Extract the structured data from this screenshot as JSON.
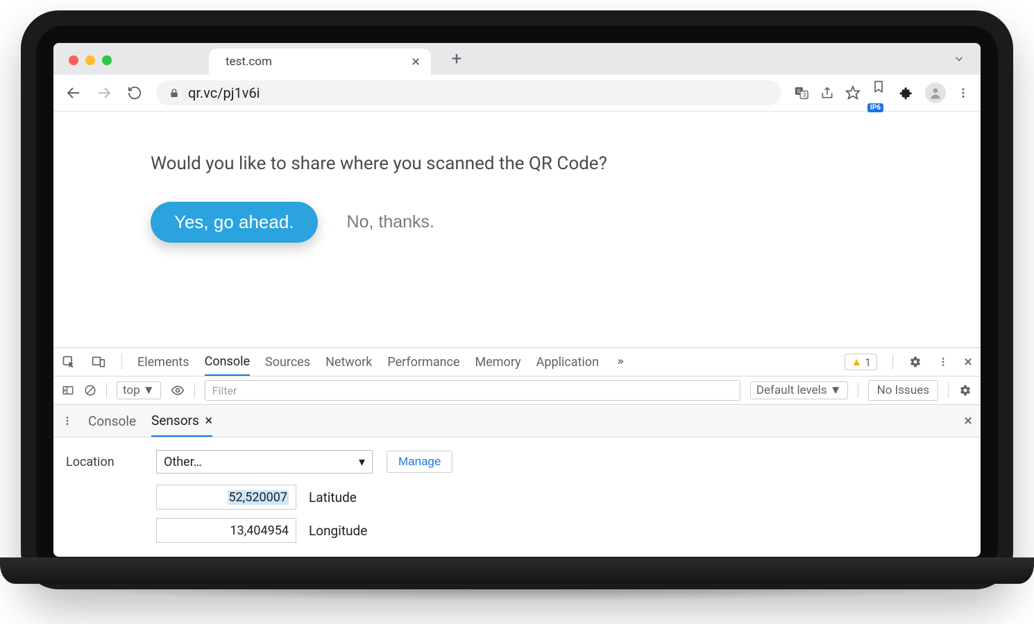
{
  "browser": {
    "tab_title": "test.com",
    "url": "qr.vc/pj1v6i",
    "ip_badge": "IP6"
  },
  "page": {
    "question": "Would you like to share where you scanned the QR Code?",
    "yes": "Yes, go ahead.",
    "no": "No, thanks."
  },
  "devtools": {
    "tabs": [
      "Elements",
      "Console",
      "Sources",
      "Network",
      "Performance",
      "Memory",
      "Application"
    ],
    "active_tab": "Console",
    "warning_count": "1",
    "context": "top",
    "filter_placeholder": "Filter",
    "levels": "Default levels",
    "issues": "No Issues"
  },
  "drawer": {
    "tabs": [
      "Console",
      "Sensors"
    ],
    "active_tab": "Sensors"
  },
  "sensors": {
    "section": "Location",
    "preset": "Other…",
    "manage": "Manage",
    "latitude_value": "52,520007",
    "latitude_label": "Latitude",
    "longitude_value": "13,404954",
    "longitude_label": "Longitude"
  }
}
